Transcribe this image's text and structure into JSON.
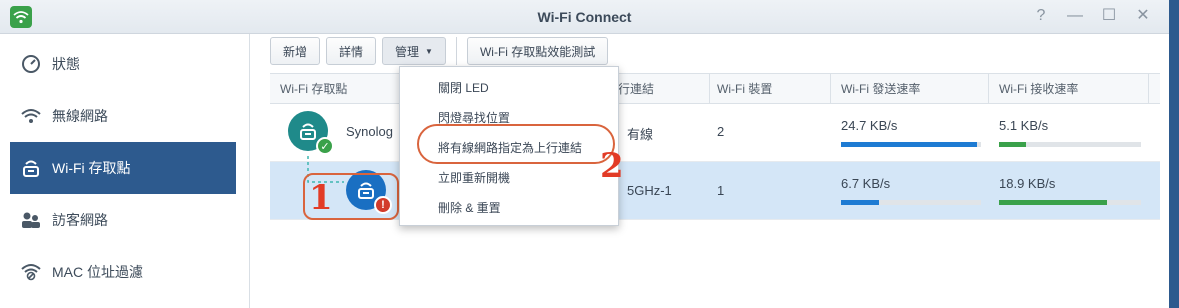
{
  "window": {
    "title": "Wi-Fi Connect"
  },
  "window_controls": [
    "?",
    "—",
    "☐",
    "✕"
  ],
  "sidebar": {
    "items": [
      {
        "label": "狀態",
        "icon": "status-dial-icon"
      },
      {
        "label": "無線網路",
        "icon": "wifi-icon"
      },
      {
        "label": "Wi-Fi 存取點",
        "icon": "access-point-icon",
        "active": true
      },
      {
        "label": "訪客網路",
        "icon": "guests-icon"
      },
      {
        "label": "MAC 位址過濾",
        "icon": "wifi-filter-icon"
      }
    ]
  },
  "toolbar": {
    "add_label": "新增",
    "details_label": "詳情",
    "manage_label": "管理",
    "perf_test_label": "Wi-Fi 存取點效能測試"
  },
  "table": {
    "columns": [
      "Wi-Fi 存取點",
      "行連結",
      "Wi-Fi 裝置",
      "Wi-Fi 發送速率",
      "Wi-Fi 接收速率"
    ],
    "rows": [
      {
        "name": "Synolog",
        "uplink": "有線",
        "devices": "2",
        "tx": "24.7 KB/s",
        "tx_level": 0.97,
        "rx": "5.1 KB/s",
        "rx_level": 0.19
      },
      {
        "name": "",
        "uplink": "5GHz-1",
        "devices": "1",
        "tx": "6.7 KB/s",
        "tx_level": 0.27,
        "rx": "18.9 KB/s",
        "rx_level": 0.76
      }
    ]
  },
  "menu": {
    "items": [
      "關閉 LED",
      "閃燈尋找位置",
      "將有線網路指定為上行連結",
      "立即重新開機",
      "刪除 & 重置"
    ]
  },
  "annotations": {
    "num1": "1",
    "num2": "2"
  },
  "colors": {
    "accent": "#2d5a8e",
    "tx_bar": "#1e7bd3",
    "rx_bar": "#3aa14a",
    "annotation": "#e23b26"
  }
}
